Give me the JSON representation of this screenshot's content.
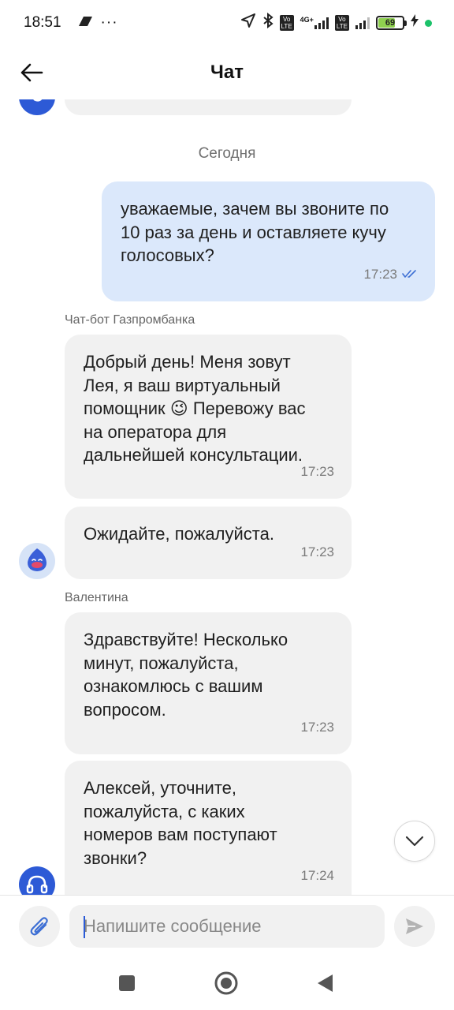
{
  "status_bar": {
    "time": "18:51",
    "battery": "69",
    "battery_level": 0.69,
    "icons": [
      "dots-icon",
      "location-icon",
      "bluetooth-icon",
      "volte-icon",
      "4g-icon",
      "signal-icon",
      "battery-icon",
      "charging-icon"
    ]
  },
  "header": {
    "title": "Чат",
    "back_icon": "arrow-left-icon"
  },
  "chat": {
    "date_separator": "Сегодня",
    "messages": [
      {
        "direction": "out",
        "lines": [
          "уважаемые, зачем вы звоните по",
          "10 раз за день и оставляете кучу",
          "голосовых?"
        ],
        "time": "17:23",
        "read": true
      },
      {
        "sender": "Чат-бот Газпромбанка",
        "direction": "in",
        "lines": [
          "Добрый день! Меня зовут",
          "Лея, я ваш виртуальный",
          "помощник 😉 Перевожу вас",
          "на оператора для",
          "дальнейшей консультации."
        ],
        "time": "17:23"
      },
      {
        "direction": "in",
        "lines": [
          "Ожидайте, пожалуйста."
        ],
        "time": "17:23"
      },
      {
        "sender": "Валентина",
        "direction": "in",
        "lines": [
          "Здравствуйте! Несколько",
          "минут, пожалуйста,",
          "ознакомлюсь с вашим",
          "вопросом."
        ],
        "time": "17:23"
      },
      {
        "direction": "in",
        "lines": [
          "Алексей, уточните,",
          "пожалуйста, с каких",
          "номеров вам поступают",
          "звонки?"
        ],
        "time": "17:24"
      }
    ]
  },
  "input": {
    "placeholder": "Напишите сообщение",
    "value": ""
  },
  "colors": {
    "accent": "#2a5bd7",
    "incoming_bubble": "#f1f1f1",
    "outgoing_bubble": "#dbe8fb"
  }
}
